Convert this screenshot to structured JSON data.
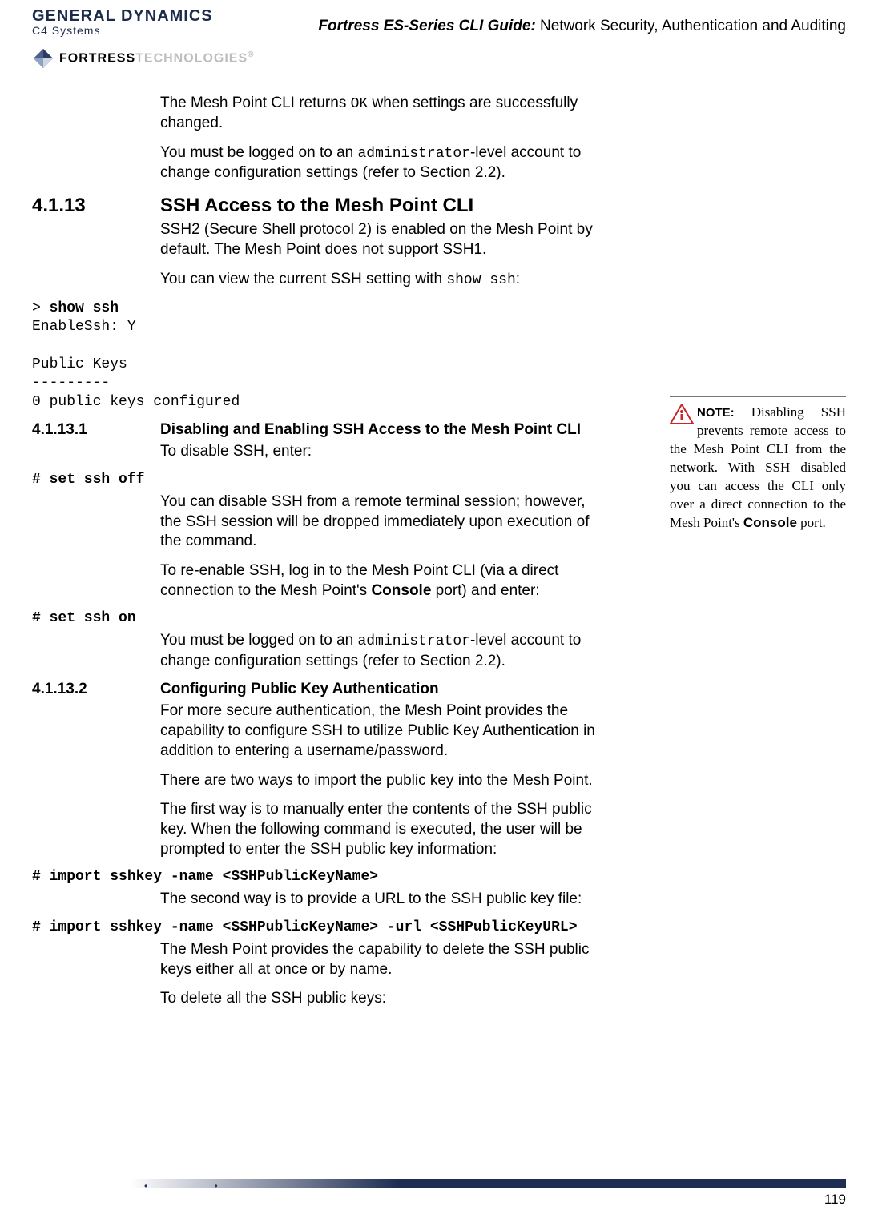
{
  "header": {
    "logo_top": "GENERAL DYNAMICS",
    "logo_sub": "C4 Systems",
    "fortress": "FORTRESS",
    "technologies": "TECHNOLOGIES",
    "title_bold": "Fortress ES-Series CLI Guide:",
    "title_rest": " Network Security, Authentication and Auditing"
  },
  "intro": {
    "p1a": "The Mesh Point CLI returns ",
    "p1_code": "OK",
    "p1b": " when settings are successfully changed.",
    "p2a": "You must be logged on to an ",
    "p2_code": "administrator",
    "p2b": "-level account to change configuration settings (refer to Section 2.2)."
  },
  "s4113": {
    "num": "4.1.13",
    "title": "SSH Access to the Mesh Point CLI",
    "p1": "SSH2 (Secure Shell protocol 2) is enabled on the Mesh Point by default. The Mesh Point does not support SSH1.",
    "p2a": "You can view the current SSH setting with ",
    "p2_code": "show ssh",
    "p2b": ":",
    "cli_prompt": "> ",
    "cli_cmd": "show ssh",
    "cli_out": "EnableSsh: Y\n\nPublic Keys\n---------\n0 public keys configured"
  },
  "s41131": {
    "num": "4.1.13.1",
    "title": "Disabling and Enabling SSH Access to the Mesh Point CLI",
    "p1": "To disable SSH, enter:",
    "cli1": "# set ssh off",
    "p2": "You can disable SSH from a remote terminal session; however, the SSH session will be dropped immediately upon execution of the command.",
    "p3a": "To re-enable SSH, log in to the Mesh Point CLI (via a direct connection to the Mesh Point's ",
    "p3_bold": "Console",
    "p3b": " port) and enter:",
    "cli2": "# set ssh on",
    "p4a": "You must be logged on to an ",
    "p4_code": "administrator",
    "p4b": "-level account to change configuration settings (refer to Section 2.2)."
  },
  "s41132": {
    "num": "4.1.13.2",
    "title": "Configuring Public Key Authentication",
    "p1": "For more secure authentication, the Mesh Point provides the capability to configure SSH to utilize Public Key Authentication in addition to entering a username/password.",
    "p2": "There are two ways to import the public key into the Mesh Point.",
    "p3": "The first way is to manually enter the contents of the SSH public key. When the following command is executed, the user will be prompted to enter the SSH public key information:",
    "cli1": "# import sshkey -name <SSHPublicKeyName>",
    "p4": "The second way is to provide a URL to the SSH public key file:",
    "cli2": "# import sshkey -name <SSHPublicKeyName> -url <SSHPublicKeyURL>",
    "p5": "The Mesh Point provides the capability to delete the SSH public keys either all at once or by name.",
    "p6": "To delete all the SSH public keys:"
  },
  "note": {
    "label": "NOTE:",
    "text_a": " Disabling SSH prevents remote access to the Mesh Point CLI from the network. With SSH disabled you can access the CLI only over a direct connection to the Mesh Point's ",
    "bold": "Console",
    "text_b": " port."
  },
  "footer": {
    "page": "119"
  }
}
